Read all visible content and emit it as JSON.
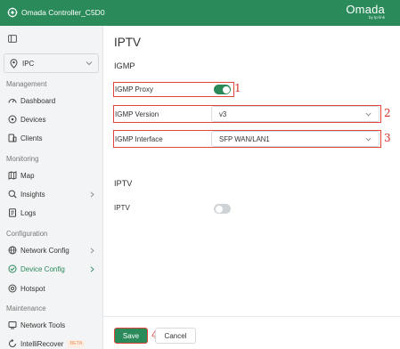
{
  "topbar": {
    "app_title": "Omada Controller_C5D0",
    "brand_name": "Omada",
    "brand_sub": "by tp-link"
  },
  "sidebar": {
    "site": "IPC",
    "sections": {
      "management": "Management",
      "monitoring": "Monitoring",
      "configuration": "Configuration",
      "maintenance": "Maintenance"
    },
    "items": {
      "dashboard": "Dashboard",
      "devices": "Devices",
      "clients": "Clients",
      "map": "Map",
      "insights": "Insights",
      "logs": "Logs",
      "network_config": "Network Config",
      "device_config": "Device Config",
      "hotspot": "Hotspot",
      "network_tools": "Network Tools",
      "intellirecover": "IntelliRecover",
      "intellirecover_badge": "BETA"
    },
    "active_item": "Device Config"
  },
  "main": {
    "page_title": "IPTV",
    "igmp_section": "IGMP",
    "igmp_proxy_label": "IGMP Proxy",
    "igmp_proxy_enabled": true,
    "igmp_version_label": "IGMP Version",
    "igmp_version_value": "v3",
    "igmp_interface_label": "IGMP Interface",
    "igmp_interface_value": "SFP WAN/LAN1",
    "iptv_section": "IPTV",
    "iptv_label": "IPTV",
    "iptv_enabled": false,
    "save_label": "Save",
    "cancel_label": "Cancel"
  },
  "annotations": {
    "callout_1": "1",
    "callout_2": "2",
    "callout_3": "3",
    "callout_4": "4"
  },
  "colors": {
    "brand_green": "#2a8a5a",
    "highlight_red": "#e0453c"
  }
}
